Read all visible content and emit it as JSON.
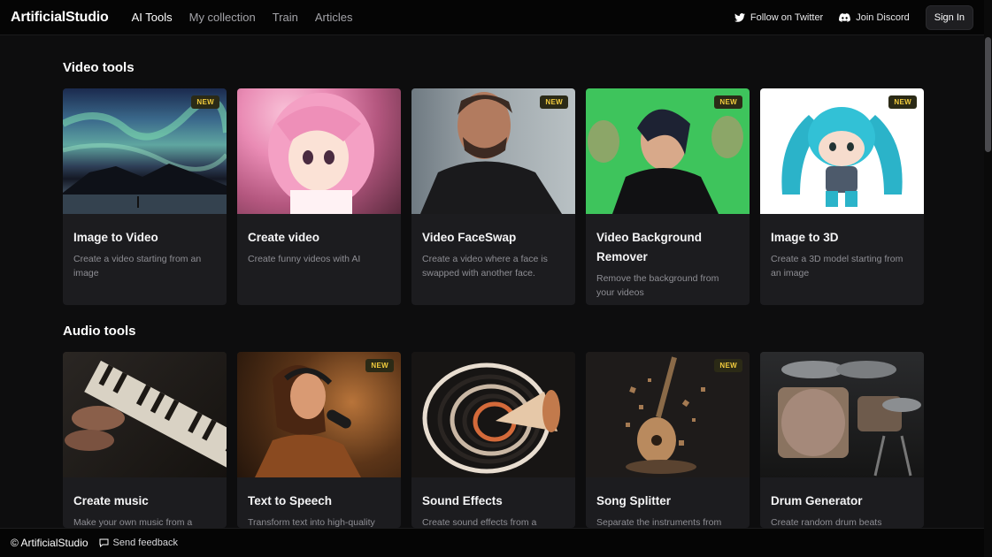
{
  "nav": {
    "brand": "ArtificialStudio",
    "links": [
      "AI Tools",
      "My collection",
      "Train",
      "Articles"
    ],
    "twitter": "Follow on Twitter",
    "discord": "Join Discord",
    "signin": "Sign In"
  },
  "video": {
    "title": "Video tools",
    "cards": [
      {
        "title": "Image to Video",
        "desc": "Create a video starting from an image",
        "badge": "NEW"
      },
      {
        "title": "Create video",
        "desc": "Create funny videos with AI",
        "badge": ""
      },
      {
        "title": "Video FaceSwap",
        "desc": "Create a video where a face is swapped with another face.",
        "badge": "NEW"
      },
      {
        "title": "Video Background Remover",
        "desc": "Remove the background from your videos",
        "badge": "NEW"
      },
      {
        "title": "Image to 3D",
        "desc": "Create a 3D model starting from an image",
        "badge": "NEW"
      }
    ]
  },
  "audio": {
    "title": "Audio tools",
    "cards": [
      {
        "title": "Create music",
        "desc": "Make your own music from a",
        "badge": ""
      },
      {
        "title": "Text to Speech",
        "desc": "Transform text into high-quality",
        "badge": "NEW"
      },
      {
        "title": "Sound Effects",
        "desc": "Create sound effects from a",
        "badge": ""
      },
      {
        "title": "Song Splitter",
        "desc": "Separate the instruments from",
        "badge": "NEW"
      },
      {
        "title": "Drum Generator",
        "desc": "Create random drum beats",
        "badge": ""
      }
    ]
  },
  "footer": {
    "brand": "© ArtificialStudio",
    "feedback": "Send feedback"
  }
}
